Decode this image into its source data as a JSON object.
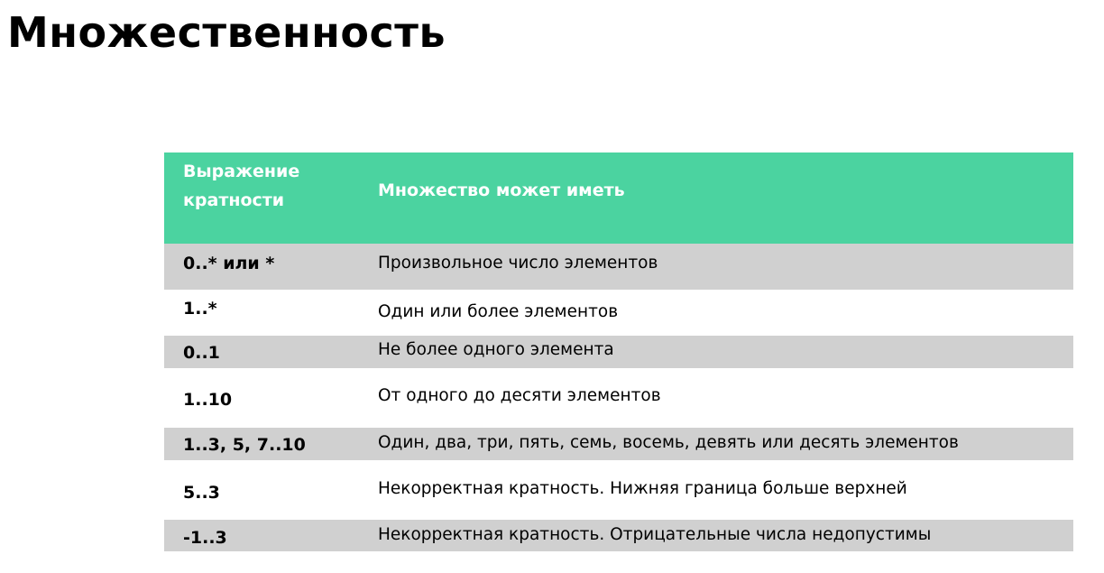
{
  "title": "Множественность",
  "table": {
    "headers": {
      "expression": "Выражение кратности",
      "description": "Множество может иметь"
    },
    "rows": [
      {
        "expression": "0..* или *",
        "description": "Произвольное число элементов"
      },
      {
        "expression": "1..*",
        "description": "Один или более элементов"
      },
      {
        "expression": "0..1",
        "description": "Не более одного элемента"
      },
      {
        "expression": "1..10",
        "description": "От одного до десяти элементов"
      },
      {
        "expression": "1..3, 5, 7..10",
        "description": "Один, два, три, пять, семь, восемь, девять или десять элементов"
      },
      {
        "expression": "5..3",
        "description": "Некорректная кратность. Нижняя граница больше верхней"
      },
      {
        "expression": "-1..3",
        "description": "Некорректная кратность. Отрицательные числа недопустимы"
      }
    ]
  },
  "colors": {
    "header_background": "#4bd3a0",
    "header_text": "#ffffff",
    "shaded_row": "#d0d0d0",
    "plain_row": "#ffffff"
  }
}
